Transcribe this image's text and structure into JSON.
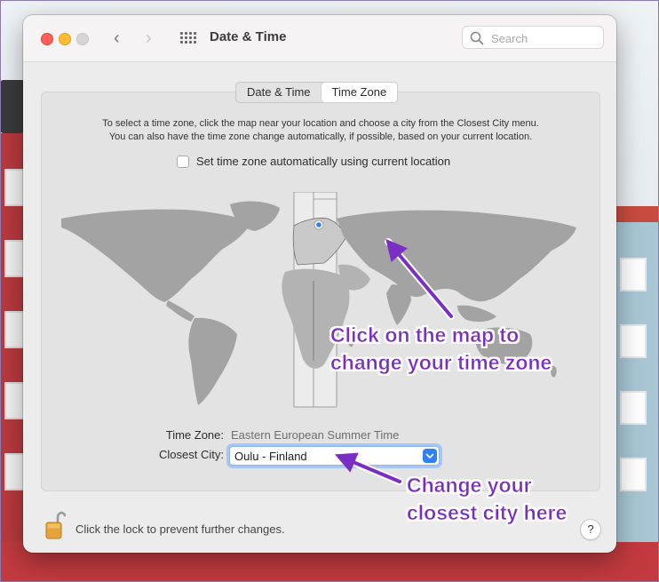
{
  "window": {
    "title": "Date & Time",
    "nav": {
      "back_glyph": "‹",
      "forward_glyph": "›"
    },
    "search": {
      "placeholder": "Search"
    }
  },
  "tabs": [
    {
      "label": "Date & Time",
      "active": false
    },
    {
      "label": "Time Zone",
      "active": true
    }
  ],
  "instructions": {
    "line1": "To select a time zone, click the map near your location and choose a city from the Closest City menu.",
    "line2": "You can also have the time zone change automatically, if possible, based on your current location."
  },
  "auto_timezone": {
    "label": "Set time zone automatically using current location",
    "checked": false
  },
  "time_zone": {
    "label": "Time Zone:",
    "value": "Eastern European Summer Time"
  },
  "closest_city": {
    "label": "Closest City:",
    "value": "Oulu - Finland"
  },
  "lock": {
    "text": "Click the lock to prevent further changes."
  },
  "help": {
    "label": "?"
  },
  "annotations": {
    "map": {
      "line1": "Click on the map to",
      "line2": "change your time zone"
    },
    "city": {
      "line1": "Change your",
      "line2": "closest city here"
    }
  },
  "colors": {
    "annotation": "#7b2ec5",
    "map_land": "#a3a3a3",
    "selected_zone": "#c9c9c9",
    "accent": "#2f7ff6"
  }
}
